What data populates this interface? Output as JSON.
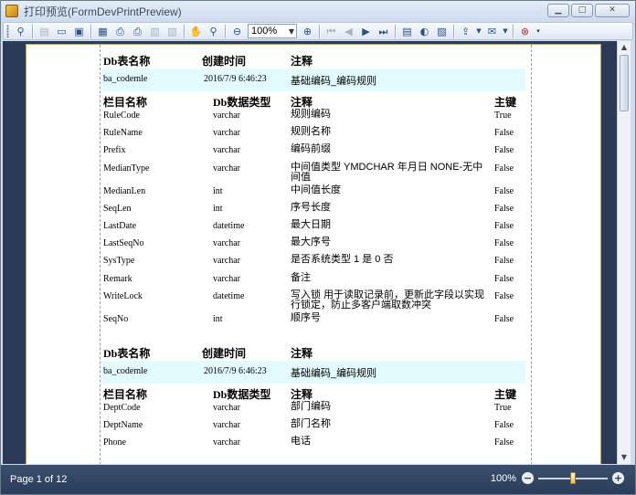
{
  "window": {
    "title": "打印预览(FormDevPrintPreview)"
  },
  "window_controls": {
    "minimize": "▁",
    "maximize": "□",
    "close": "✕"
  },
  "toolbar": {
    "zoom_value": "100%",
    "icons": [
      "binoculars-icon",
      "open-icon",
      "folder-icon",
      "save-icon",
      "page-setup-icon",
      "print-icon",
      "print-quick-icon",
      "page-layout-icon",
      "watermark-icon",
      "hand-icon",
      "magnifier-icon",
      "zoom-out-icon",
      "zoom-in-icon",
      "first-page-icon",
      "prev-page-icon",
      "next-page-icon",
      "last-page-icon",
      "multi-page-icon",
      "color-icon",
      "watermark2-icon",
      "export-icon",
      "send-icon",
      "close-preview-icon"
    ]
  },
  "document": {
    "header": {
      "col1": "Db表名称",
      "col2": "创建时间",
      "col3": "注释"
    },
    "field_header": {
      "col1": "栏目名称",
      "col2": "Db数据类型",
      "col3": "注释",
      "col4": "主键"
    },
    "tables": [
      {
        "name": "ba_codemle",
        "created": "2016/7/9 6:46:23",
        "comment": "基础编码_编码规则",
        "fields": [
          {
            "name": "RuleCode",
            "type": "varchar",
            "comment": "规则编码",
            "pk": "True"
          },
          {
            "name": "RuleName",
            "type": "varchar",
            "comment": "规则名称",
            "pk": "False"
          },
          {
            "name": "Prefix",
            "type": "varchar",
            "comment": "编码前缀",
            "pk": "False"
          },
          {
            "name": "MedianType",
            "type": "varchar",
            "comment": "中间值类型 YMDCHAR 年月日 NONE-无中间值",
            "pk": "False"
          },
          {
            "name": "MedianLen",
            "type": "int",
            "comment": "中间值长度",
            "pk": "False"
          },
          {
            "name": "SeqLen",
            "type": "int",
            "comment": "序号长度",
            "pk": "False"
          },
          {
            "name": "LastDate",
            "type": "datetime",
            "comment": "最大日期",
            "pk": "False"
          },
          {
            "name": "LastSeqNo",
            "type": "varchar",
            "comment": "最大序号",
            "pk": "False"
          },
          {
            "name": "SysType",
            "type": "varchar",
            "comment": "是否系统类型 1 是 0 否",
            "pk": "False"
          },
          {
            "name": "Remark",
            "type": "varchar",
            "comment": "备注",
            "pk": "False"
          },
          {
            "name": "WriteLock",
            "type": "datetime",
            "comment": "写入锁 用于读取记录前，更新此字段以实现行锁定，防止多客户端取数冲突",
            "pk": "False"
          },
          {
            "name": "SeqNo",
            "type": "int",
            "comment": "顺序号",
            "pk": "False"
          }
        ]
      },
      {
        "name": "ba_codemle",
        "created": "2016/7/9 6:46:23",
        "comment": "基础编码_编码规则",
        "fields": [
          {
            "name": "DeptCode",
            "type": "varchar",
            "comment": "部门编码",
            "pk": "True"
          },
          {
            "name": "DeptName",
            "type": "varchar",
            "comment": "部门名称",
            "pk": "False"
          },
          {
            "name": "Phone",
            "type": "varchar",
            "comment": "电话",
            "pk": "False"
          }
        ]
      }
    ]
  },
  "status": {
    "page_info": "Page 1 of 12",
    "zoom_label": "100%",
    "zoom_level_fraction": 0.5
  },
  "colors": {
    "doc_background": "#2b3a55",
    "table_row_highlight": "#e3fbfd",
    "statusbar": "#2b3d59"
  }
}
